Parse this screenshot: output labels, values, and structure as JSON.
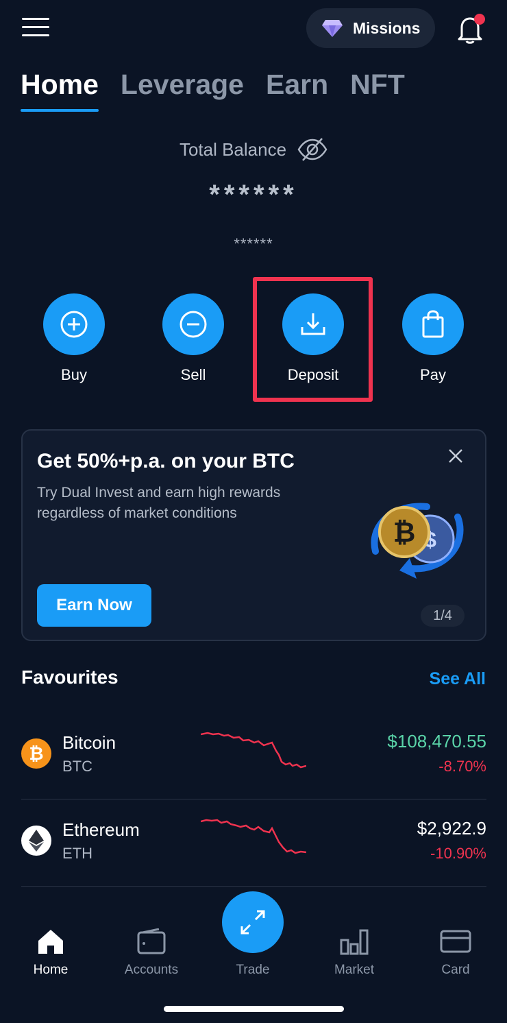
{
  "header": {
    "missions_label": "Missions"
  },
  "tabs": [
    {
      "label": "Home",
      "active": true
    },
    {
      "label": "Leverage",
      "active": false
    },
    {
      "label": "Earn",
      "active": false
    },
    {
      "label": "NFT",
      "active": false
    }
  ],
  "balance": {
    "label": "Total Balance",
    "value_masked": "******",
    "sub_masked": "******"
  },
  "actions": [
    {
      "label": "Buy",
      "icon": "plus-circle-icon"
    },
    {
      "label": "Sell",
      "icon": "minus-circle-icon"
    },
    {
      "label": "Deposit",
      "icon": "download-icon",
      "highlighted": true
    },
    {
      "label": "Pay",
      "icon": "shopping-bag-icon"
    }
  ],
  "promo": {
    "title": "Get 50%+p.a. on your BTC",
    "description": "Try Dual Invest and earn high rewards regardless of market conditions",
    "button": "Earn Now",
    "pager": "1/4"
  },
  "favourites": {
    "title": "Favourites",
    "see_all": "See All",
    "items": [
      {
        "name": "Bitcoin",
        "symbol": "BTC",
        "price": "$108,470.55",
        "change": "-8.70%",
        "price_color": "#5ad3a8"
      },
      {
        "name": "Ethereum",
        "symbol": "ETH",
        "price": "$2,922.9",
        "change": "-10.90%",
        "price_color": "#ffffff"
      }
    ]
  },
  "bottom_nav": [
    {
      "label": "Home",
      "icon": "home-icon",
      "active": true
    },
    {
      "label": "Accounts",
      "icon": "wallet-icon",
      "active": false
    },
    {
      "label": "Trade",
      "icon": "trade-arrows-icon",
      "active": false
    },
    {
      "label": "Market",
      "icon": "bar-chart-icon",
      "active": false
    },
    {
      "label": "Card",
      "icon": "card-icon",
      "active": false
    }
  ],
  "colors": {
    "accent": "#1a9cf6",
    "background": "#0b1425",
    "negative": "#f0334f",
    "positive": "#5ad3a8",
    "highlight_box": "#f0334f"
  }
}
